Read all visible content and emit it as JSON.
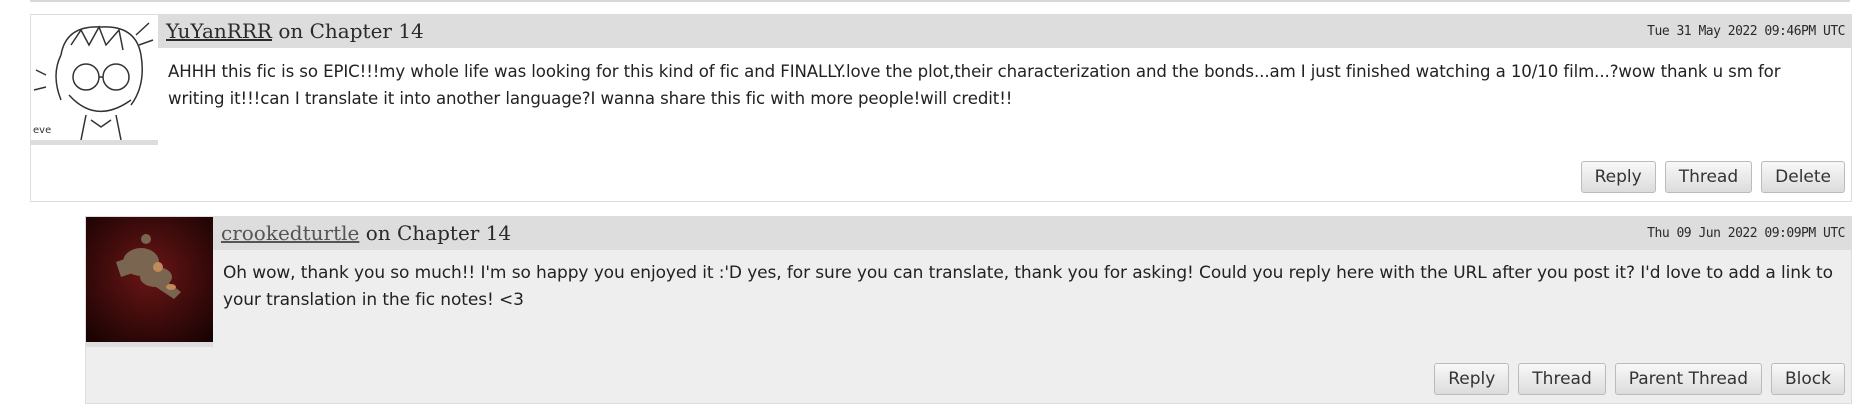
{
  "comments": [
    {
      "author": "YuYanRRR",
      "on_text": "on Chapter 14",
      "date": "Tue 31 May 2022 09:46PM UTC",
      "body": "AHHH this fic is so EPIC!!!my whole life was looking for this kind of fic and FINALLY.love the plot,their characterization and the bonds...am I just finished watching a 10/10 film...?wow thank u sm for writing it!!!can I translate it into another language?I wanna share this fic with more people!will credit!!",
      "actions": [
        "Reply",
        "Thread",
        "Delete"
      ]
    },
    {
      "author": "crookedturtle",
      "on_text": "on Chapter 14",
      "date": "Thu 09 Jun 2022 09:09PM UTC",
      "body": "Oh wow, thank you so much!! I'm so happy you enjoyed it :'D yes, for sure you can translate, thank you for asking! Could you reply here with the URL after you post it? I'd love to add a link to your translation in the fic notes! <3",
      "actions": [
        "Reply",
        "Thread",
        "Parent Thread",
        "Block"
      ]
    }
  ],
  "colors": {
    "byline_bg": "#dddddd",
    "reply_bg": "#eeeeee",
    "border": "#dddddd"
  },
  "icons": [
    "avatar-sketch-icon",
    "avatar-dark-icon"
  ]
}
